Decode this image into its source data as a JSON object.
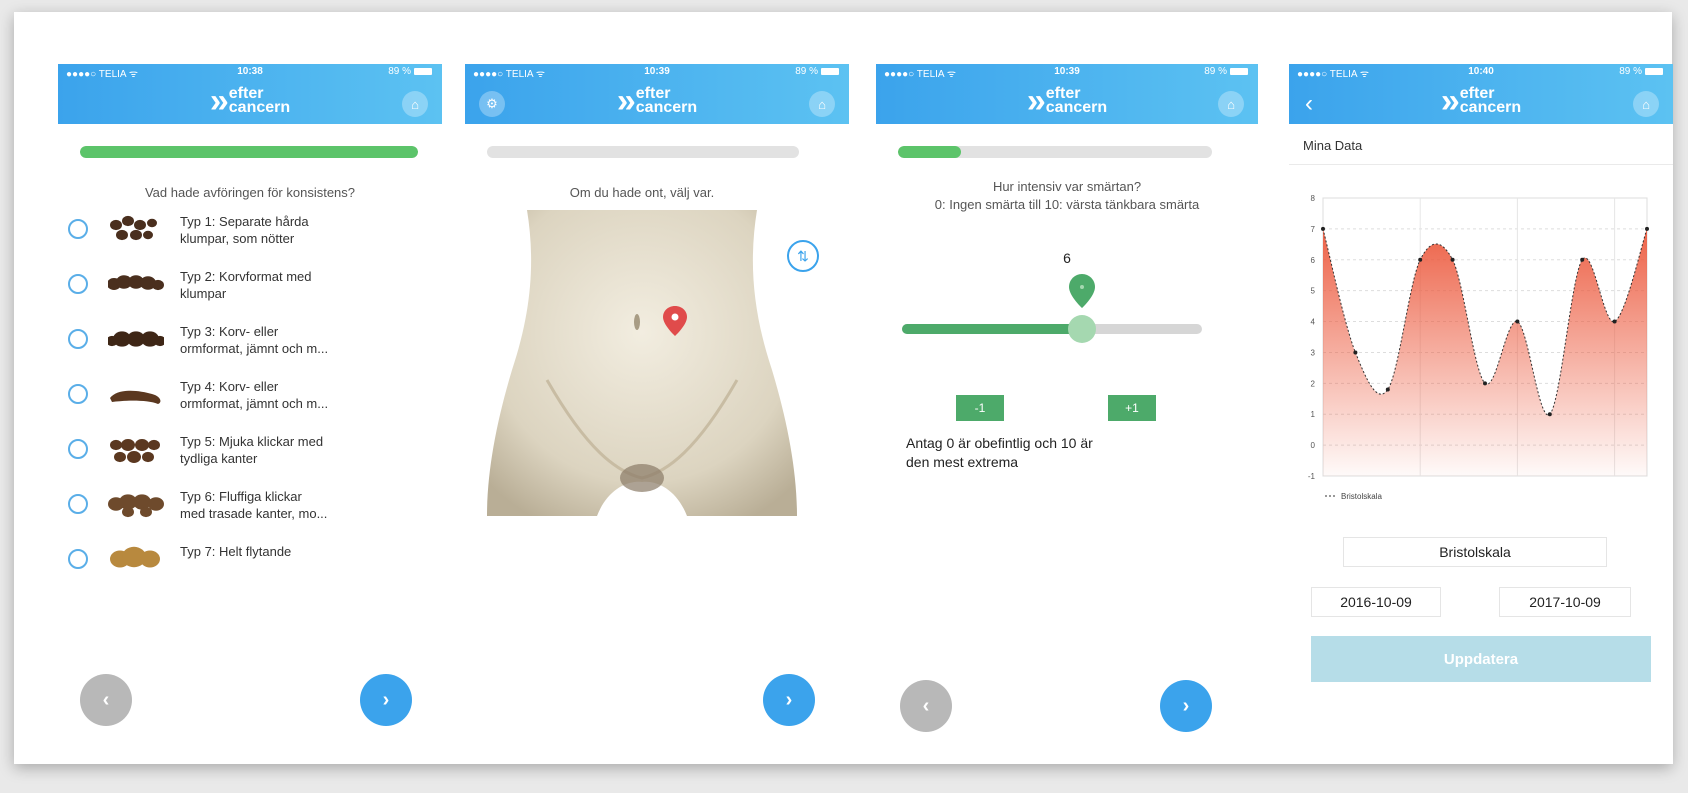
{
  "status_bar": {
    "carrier": "●●●●○ TELIA ᯤ",
    "battery": "89 %",
    "times": [
      "10:38",
      "10:39",
      "10:39",
      "10:40"
    ]
  },
  "app": {
    "logo_line1": "efter",
    "logo_line2": "cancern",
    "brand_color": "#3ba3ec",
    "accent_green": "#4daa6a"
  },
  "screen1": {
    "progress": 1.0,
    "question": "Vad hade avföringen för konsistens?",
    "options": [
      {
        "line1": "Typ 1: Separate hårda",
        "line2": "klumpar, som nötter",
        "color": "#4a2f1e"
      },
      {
        "line1": "Typ 2: Korvformat med",
        "line2": "klumpar",
        "color": "#4a2f1e"
      },
      {
        "line1": "Typ 3: Korv- eller",
        "line2": "ormformat, jämnt och m...",
        "color": "#3e2616"
      },
      {
        "line1": "Typ 4: Korv- eller",
        "line2": "ormformat, jämnt och m...",
        "color": "#5b3820"
      },
      {
        "line1": "Typ 5: Mjuka klickar med",
        "line2": "tydliga kanter",
        "color": "#5b3820"
      },
      {
        "line1": "Typ 6: Fluffiga klickar",
        "line2": "med trasade kanter, mo...",
        "color": "#6e4a2c"
      },
      {
        "line1": "Typ 7: Helt flytande",
        "line2": "",
        "color": "#b8893e"
      }
    ],
    "prev_glyph": "‹",
    "next_glyph": "›"
  },
  "screen2": {
    "progress": 0.0,
    "question": "Om du hade ont, välj var.",
    "swap_glyph": "⇅",
    "next_glyph": "›"
  },
  "screen3": {
    "progress": 0.2,
    "question_line1": "Hur intensiv var smärtan?",
    "question_line2": "0: Ingen smärta till 10: värsta tänkbara smärta",
    "slider_value": "6",
    "slider_fraction": 0.6,
    "minus_label": "-1",
    "plus_label": "+1",
    "note_line1": "Antag 0 är obefintlig och 10 är",
    "note_line2": "den mest extrema",
    "prev_glyph": "‹",
    "next_glyph": "›"
  },
  "screen4": {
    "back_glyph": "‹",
    "title": "Mina Data",
    "selector_label": "Bristolskala",
    "date_from": "2016-10-09",
    "date_to": "2017-10-09",
    "update_label": "Uppdatera"
  },
  "chart_data": {
    "type": "area",
    "y_ticks": [
      "8",
      "7",
      "6",
      "5",
      "4",
      "3",
      "2",
      "1",
      "0",
      "-1"
    ],
    "ylim": [
      -1,
      8
    ],
    "series": [
      {
        "name": "Bristolskala",
        "x": [
          0,
          1,
          2,
          3,
          4,
          5,
          6,
          7,
          8,
          9,
          10
        ],
        "values": [
          7,
          3,
          1.8,
          6,
          6,
          2,
          4,
          1,
          6,
          4,
          7
        ]
      }
    ],
    "legend": "bottom-left",
    "grid": true,
    "color": "#ec5a3e"
  }
}
